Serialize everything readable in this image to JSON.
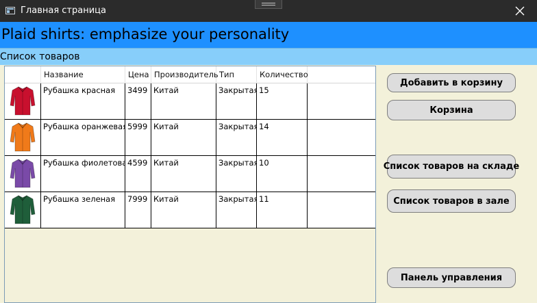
{
  "window": {
    "title": "Главная страница",
    "close_glyph": "✕"
  },
  "banner": {
    "text": "Plaid shirts: emphasize your personality"
  },
  "subheader": {
    "text": "Список товаров"
  },
  "table": {
    "columns": [
      "",
      "Название",
      "Цена",
      "Производитель",
      "Тип",
      "Количество",
      ""
    ],
    "rows": [
      {
        "image_icon": "red-shirt-icon",
        "color": "#c8102e",
        "name": "Рубашка красная",
        "price": "3499",
        "maker": "Китай",
        "type": "Закрытая",
        "qty": "15"
      },
      {
        "image_icon": "orange-shirt-icon",
        "color": "#f07a1a",
        "name": "Рубашка оранжевая",
        "price": "5999",
        "maker": "Китай",
        "type": "Закрытая",
        "qty": "14"
      },
      {
        "image_icon": "purple-shirt-icon",
        "color": "#7a4aa8",
        "name": "Рубашка фиолетовая",
        "price": "4599",
        "maker": "Китай",
        "type": "Закрытая",
        "qty": "10"
      },
      {
        "image_icon": "green-shirt-icon",
        "color": "#1f5e3a",
        "name": "Рубашка зеленая",
        "price": "7999",
        "maker": "Китай",
        "type": "Закрытая",
        "qty": "11"
      }
    ]
  },
  "buttons": {
    "add_to_cart": "Добавить в корзину",
    "cart": "Корзина",
    "warehouse_list": "Список товаров на складе",
    "hall_list": "Список товаров в зале",
    "control_panel": "Панель управления"
  },
  "colors": {
    "banner": "#1e90ff",
    "subheader": "#87cefa",
    "background": "#f3f1da"
  }
}
